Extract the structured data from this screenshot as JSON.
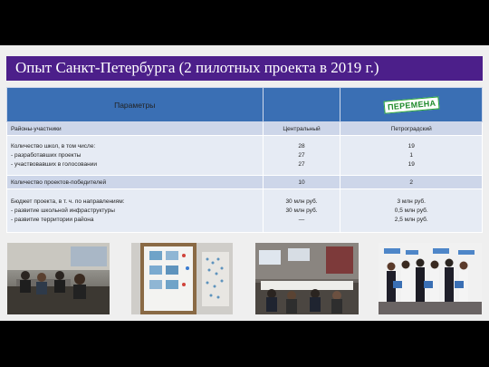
{
  "title": "Опыт Санкт-Петербурга (2 пилотных проекта в 2019 г.)",
  "table": {
    "header": {
      "col1": "Параметры",
      "col2": "",
      "col3_stamp": "ПЕРЕМЕНА"
    },
    "rows": [
      {
        "label": [
          "Районы-участники"
        ],
        "central": [
          "Центральный"
        ],
        "petro": [
          "Петроградский"
        ]
      },
      {
        "label": [
          "Количество школ, в том числе:",
          "- разработавших проекты",
          "- участвовавших в голосовании"
        ],
        "central": [
          "28",
          "27",
          "27"
        ],
        "petro": [
          "19",
          "1",
          "19"
        ]
      },
      {
        "label": [
          "Количество проектов-победителей"
        ],
        "central": [
          "10"
        ],
        "petro": [
          "2"
        ]
      },
      {
        "label": [
          "Бюджет проекта, в т. ч. по направлениям:",
          "- развитие школьной инфраструктуры",
          "- развитие территории района"
        ],
        "central": [
          "30 млн руб.",
          "30 млн руб.",
          "—"
        ],
        "petro": [
          "3 млн руб.",
          "0,5 млн руб.",
          "2,5 млн руб."
        ]
      }
    ]
  },
  "photos": [
    "classroom-photo",
    "voting-board-photo",
    "meeting-room-photo",
    "group-photo"
  ]
}
